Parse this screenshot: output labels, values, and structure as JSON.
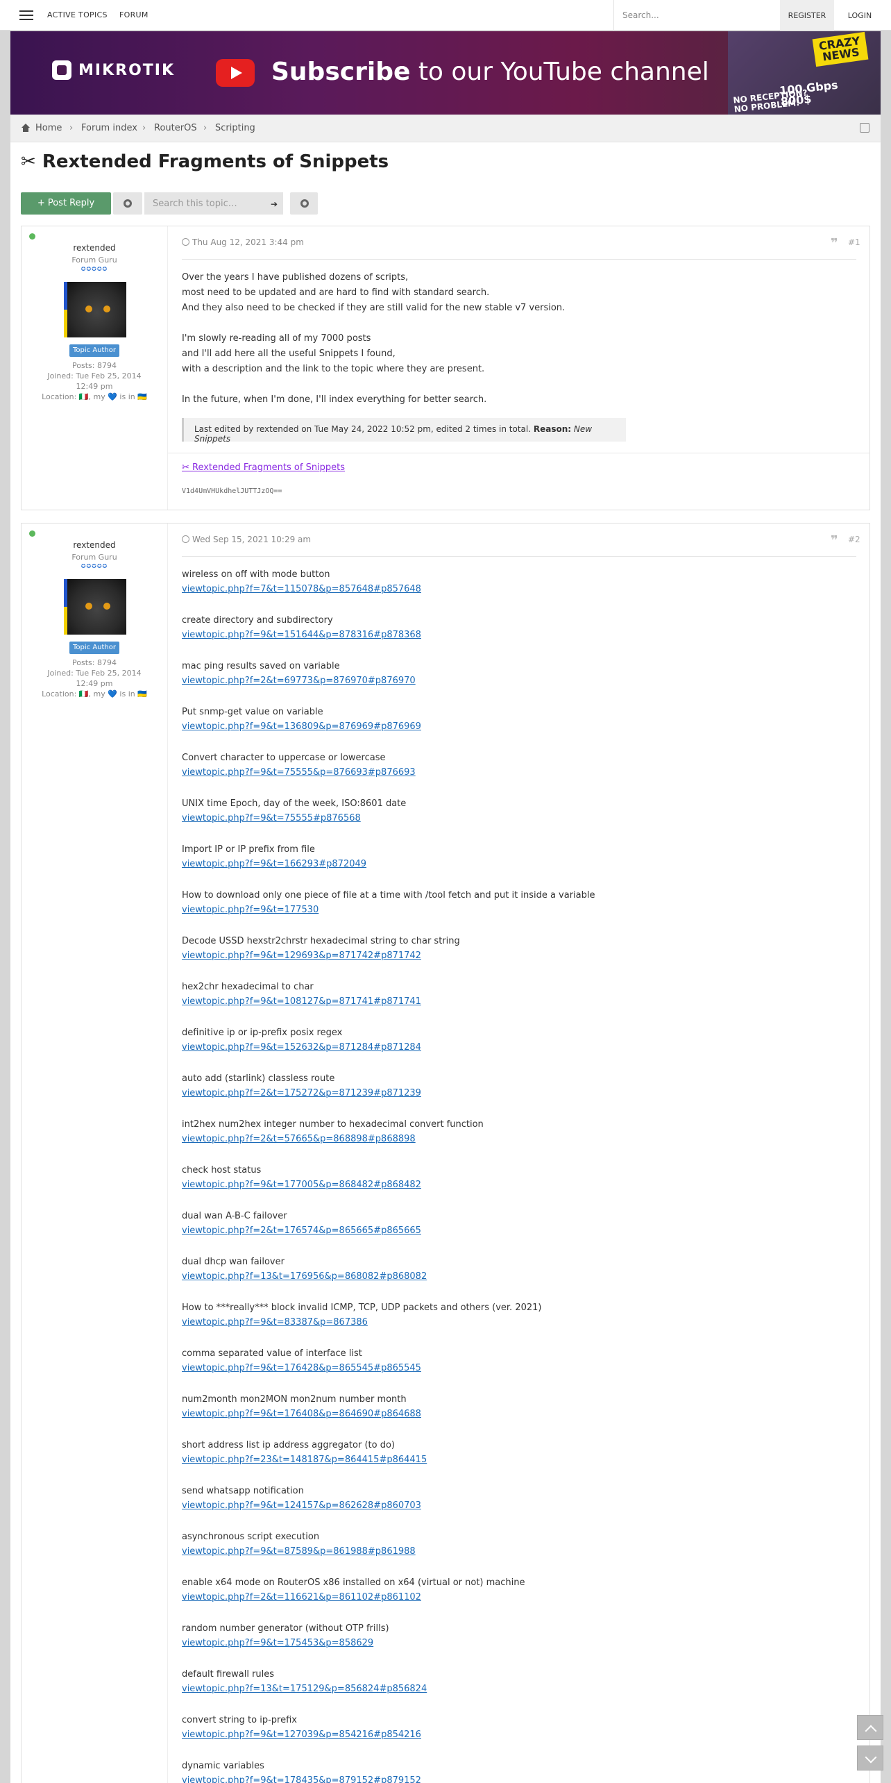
{
  "topbar": {
    "active_topics": "ACTIVE TOPICS",
    "forum": "FORUM",
    "search_placeholder": "Search...",
    "register": "REGISTER",
    "login": "LOGIN"
  },
  "banner": {
    "brand": "MIKROTIK",
    "headline_bold": "Subscribe",
    "headline_rest": " to our YouTube channel",
    "crazy_line1": "CRAZY",
    "crazy_line2": "NEWS",
    "noreception_line1": "NO RECEPTION?",
    "noreception_line2": "NO PROBLEM!",
    "gbps_line1": "100 Gbps",
    "gbps_line2": "800$"
  },
  "breadcrumb": [
    "Home",
    "Forum index",
    "RouterOS",
    "Scripting"
  ],
  "page_title": "✂ Rextended Fragments of Snippets",
  "toolbar": {
    "post_reply": "+ Post Reply",
    "search_topic_placeholder": "Search this topic…",
    "search_go": "➔"
  },
  "posts": [
    {
      "author": "rextended",
      "rank": "Forum Guru",
      "stars": "✪✪✪✪✪",
      "badge": "Topic Author",
      "posts": "Posts: 8794",
      "joined_line1": "Joined: Tue Feb 25, 2014",
      "joined_line2": "12:49 pm",
      "location": "Location: 🇮🇹, my 💙 is in 🇺🇦",
      "date": "Thu Aug 12, 2021 3:44 pm",
      "number": "#1",
      "paragraphs": [
        [
          "Over the years I have published dozens of scripts,",
          "most need to be updated and are hard to find with standard search.",
          "And they also need to be checked if they are still valid for the new stable v7 version."
        ],
        [
          "I'm slowly re-reading all of my 7000 posts",
          "and I'll add here all the useful Snippets I found,",
          "with a description and the link to the topic where they are present."
        ],
        [
          "In the future, when I'm done, I'll index everything for better search."
        ]
      ],
      "edit_note_prefix": "Last edited by rextended on Tue May 24, 2022 10:52 pm, edited 2 times in total.",
      "edit_reason_label": "Reason:",
      "edit_reason": "New Snippets",
      "signature_link": "✂ Rextended Fragments of Snippets",
      "signature_code": "V1d4UmVHUkdhelJUTTJzOQ=="
    },
    {
      "author": "rextended",
      "rank": "Forum Guru",
      "stars": "✪✪✪✪✪",
      "badge": "Topic Author",
      "posts": "Posts: 8794",
      "joined_line1": "Joined: Tue Feb 25, 2014",
      "joined_line2": "12:49 pm",
      "location": "Location: 🇮🇹, my 💙 is in 🇺🇦",
      "date": "Wed Sep 15, 2021 10:29 am",
      "number": "#2",
      "entries": [
        {
          "title": "wireless on off with mode button",
          "link": "viewtopic.php?f=7&t=115078&p=857648#p857648"
        },
        {
          "title": "create directory and subdirectory",
          "link": "viewtopic.php?f=9&t=151644&p=878316#p878368"
        },
        {
          "title": "mac ping results saved on variable",
          "link": "viewtopic.php?f=2&t=69773&p=876970#p876970"
        },
        {
          "title": "Put snmp-get value on variable",
          "link": "viewtopic.php?f=9&t=136809&p=876969#p876969"
        },
        {
          "title": "Convert character to uppercase or lowercase",
          "link": "viewtopic.php?f=9&t=75555&p=876693#p876693"
        },
        {
          "title": "UNIX time Epoch, day of the week, ISO:8601 date",
          "link": "viewtopic.php?f=9&t=75555#p876568"
        },
        {
          "title": "Import IP or IP prefix from file",
          "link": "viewtopic.php?f=9&t=166293#p872049"
        },
        {
          "title": "How to download only one piece of file at a time with /tool fetch and put it inside a variable",
          "link": "viewtopic.php?f=9&t=177530"
        },
        {
          "title": "Decode USSD hexstr2chrstr hexadecimal string to char string",
          "link": "viewtopic.php?f=9&t=129693&p=871742#p871742"
        },
        {
          "title": "hex2chr hexadecimal to char",
          "link": "viewtopic.php?f=9&t=108127&p=871741#p871741"
        },
        {
          "title": "definitive ip or ip-prefix posix regex",
          "link": "viewtopic.php?f=9&t=152632&p=871284#p871284"
        },
        {
          "title": "auto add (starlink) classless route",
          "link": "viewtopic.php?f=2&t=175272&p=871239#p871239"
        },
        {
          "title": "int2hex num2hex integer number to hexadecimal convert function",
          "link": "viewtopic.php?f=2&t=57665&p=868898#p868898"
        },
        {
          "title": "check host status",
          "link": "viewtopic.php?f=9&t=177005&p=868482#p868482"
        },
        {
          "title": "dual wan A-B-C failover",
          "link": "viewtopic.php?f=2&t=176574&p=865665#p865665"
        },
        {
          "title": "dual dhcp wan failover",
          "link": "viewtopic.php?f=13&t=176956&p=868082#p868082"
        },
        {
          "title": "How to ***really*** block invalid ICMP, TCP, UDP packets and others (ver. 2021)",
          "link": "viewtopic.php?f=9&t=83387&p=867386"
        },
        {
          "title": "comma separated value of interface list",
          "link": "viewtopic.php?f=9&t=176428&p=865545#p865545"
        },
        {
          "title": "num2month mon2MON mon2num number month",
          "link": "viewtopic.php?f=9&t=176408&p=864690#p864688"
        },
        {
          "title": "short address list ip address aggregator (to do)",
          "link": "viewtopic.php?f=23&t=148187&p=864415#p864415"
        },
        {
          "title": "send whatsapp notification",
          "link": "viewtopic.php?f=9&t=124157&p=862628#p860703"
        },
        {
          "title": "asynchronous script execution",
          "link": "viewtopic.php?f=9&t=87589&p=861988#p861988"
        },
        {
          "title": "enable x64 mode on RouterOS x86 installed on x64 (virtual or not) machine",
          "link": "viewtopic.php?f=2&t=116621&p=861102#p861102"
        },
        {
          "title": "random number generator (without OTP frills)",
          "link": "viewtopic.php?f=9&t=175453&p=858629"
        },
        {
          "title": "default firewall rules",
          "link": "viewtopic.php?f=13&t=175129&p=856824#p856824"
        },
        {
          "title": "convert string to ip-prefix",
          "link": "viewtopic.php?f=9&t=127039&p=854216#p854216"
        },
        {
          "title": "dynamic variables",
          "link": "viewtopic.php?f=9&t=178435&p=879152#p879152"
        }
      ]
    }
  ],
  "colors": {
    "reply_button": "#5a9a6b",
    "link": "#1a6ab8",
    "badge": "#4a90d0",
    "online": "#5cb85c"
  }
}
